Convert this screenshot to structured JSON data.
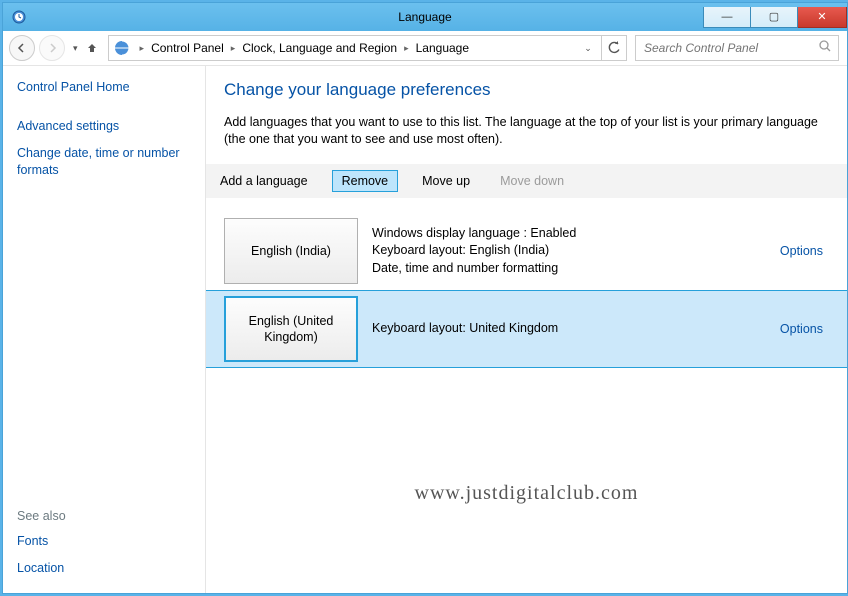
{
  "window": {
    "title": "Language"
  },
  "nav": {
    "breadcrumb": [
      "Control Panel",
      "Clock, Language and Region",
      "Language"
    ],
    "search_placeholder": "Search Control Panel"
  },
  "sidebar": {
    "home": "Control Panel Home",
    "links": [
      "Advanced settings",
      "Change date, time or number formats"
    ],
    "seealso_header": "See also",
    "seealso": [
      "Fonts",
      "Location"
    ]
  },
  "main": {
    "heading": "Change your language preferences",
    "description": "Add languages that you want to use to this list. The language at the top of your list is your primary language (the one that you want to see and use most often).",
    "toolbar": {
      "add": "Add a language",
      "remove": "Remove",
      "moveup": "Move up",
      "movedown": "Move down"
    },
    "languages": [
      {
        "name": "English (India)",
        "details": [
          "Windows display language : Enabled",
          "Keyboard layout: English (India)",
          "Date, time and number formatting"
        ],
        "options_label": "Options",
        "selected": false
      },
      {
        "name": "English (United Kingdom)",
        "details": [
          "Keyboard layout: United Kingdom"
        ],
        "options_label": "Options",
        "selected": true
      }
    ]
  },
  "watermark": "www.justdigitalclub.com"
}
